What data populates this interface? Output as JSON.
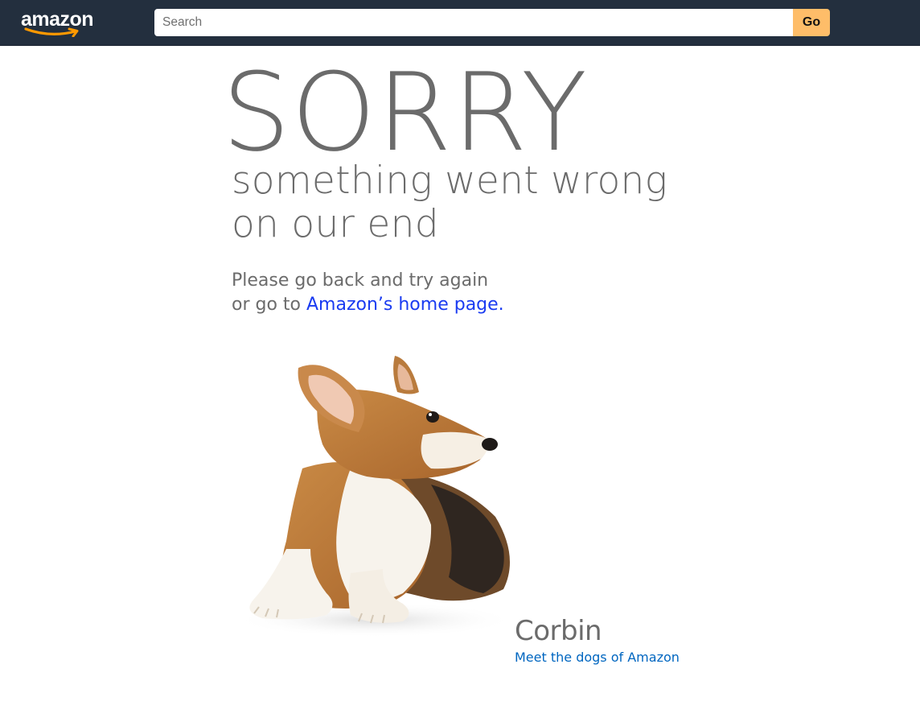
{
  "header": {
    "logo_text": "amazon",
    "search": {
      "placeholder": "Search",
      "value": ""
    },
    "go_label": "Go"
  },
  "colors": {
    "header_bg": "#232f3e",
    "go_button": "#febd69",
    "logo_smile": "#ff9900",
    "text_gray": "#6b6b6b",
    "home_link": "#1a3bf1",
    "dogs_link": "#0066c0"
  },
  "error": {
    "headline": "SORRY",
    "subheadline_line1": "something went wrong",
    "subheadline_line2": "on our end",
    "message_line1": "Please go back and try again",
    "message_line2_prefix": "or go to ",
    "home_link": "Amazon’s home page."
  },
  "dog": {
    "name": "Corbin",
    "link": "Meet the dogs of Amazon"
  }
}
